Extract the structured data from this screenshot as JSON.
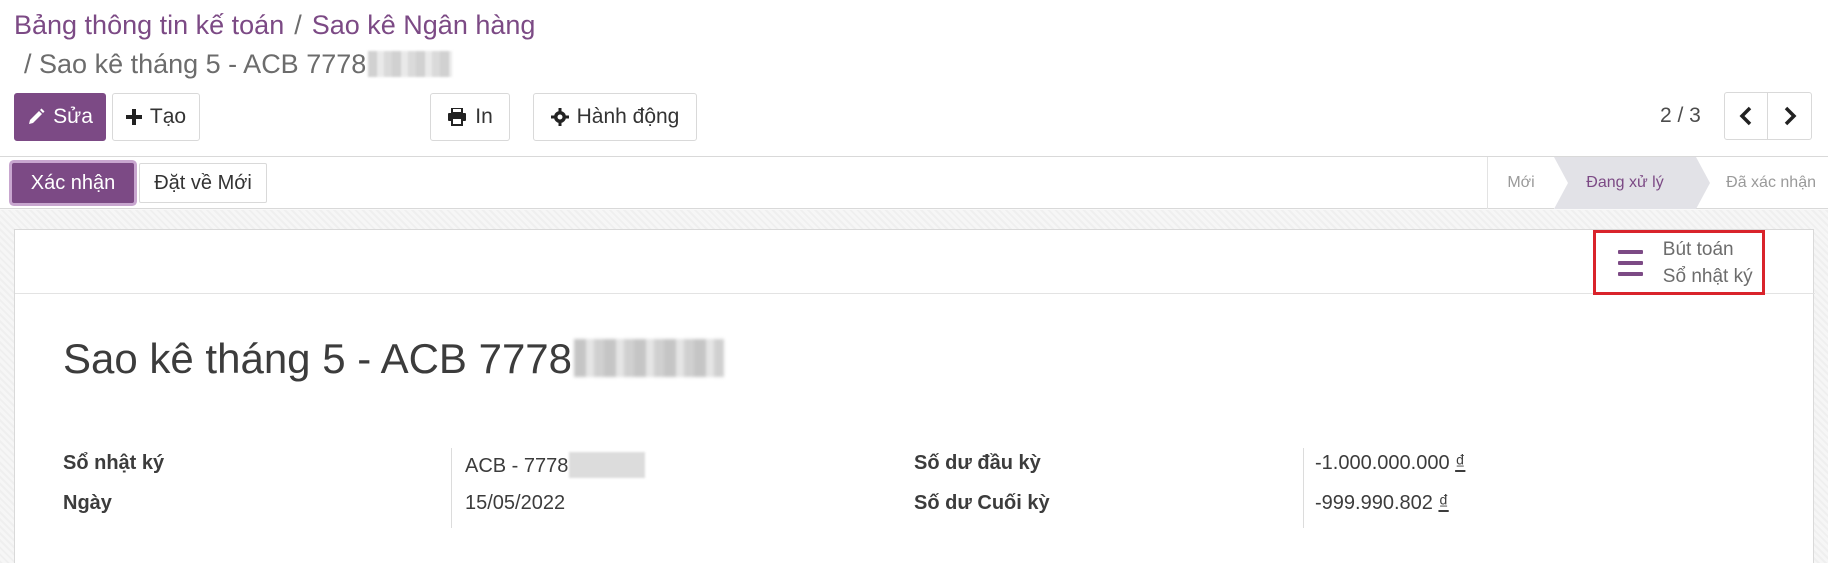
{
  "breadcrumb": {
    "items": [
      "Bảng thông tin kế toán",
      "Sao kê Ngân hàng"
    ],
    "separator": "/",
    "current": "Sao kê tháng 5 - ACB 7778"
  },
  "toolbar": {
    "edit_label": "Sửa",
    "create_label": "Tạo",
    "print_label": "In",
    "action_label": "Hành động"
  },
  "pager": {
    "value": "2 / 3"
  },
  "statusbar": {
    "confirm_label": "Xác nhận",
    "reset_label": "Đặt về Mới",
    "stages": [
      "Mới",
      "Đang xử lý",
      "Đã xác nhận"
    ],
    "current_stage": "Đang xử lý"
  },
  "smart_button": {
    "label": "Bút toán Sổ nhật ký"
  },
  "record": {
    "title": "Sao kê tháng 5 - ACB 7778",
    "journal_label": "Sổ nhật ký",
    "journal_value": "ACB - 7778",
    "date_label": "Ngày",
    "date_value": "15/05/2022",
    "balance_start_label": "Số dư đầu kỳ",
    "balance_start_value": "-1.000.000.000",
    "balance_end_label": "Số dư Cuối kỳ",
    "balance_end_value": "-999.990.802",
    "currency_symbol": "₫"
  },
  "colors": {
    "brand": "#7c4a85",
    "highlight": "#d9232b"
  },
  "icons": [
    "pencil-icon",
    "plus-icon",
    "print-icon",
    "gear-icon",
    "chevron-left-icon",
    "chevron-right-icon",
    "list-icon"
  ]
}
